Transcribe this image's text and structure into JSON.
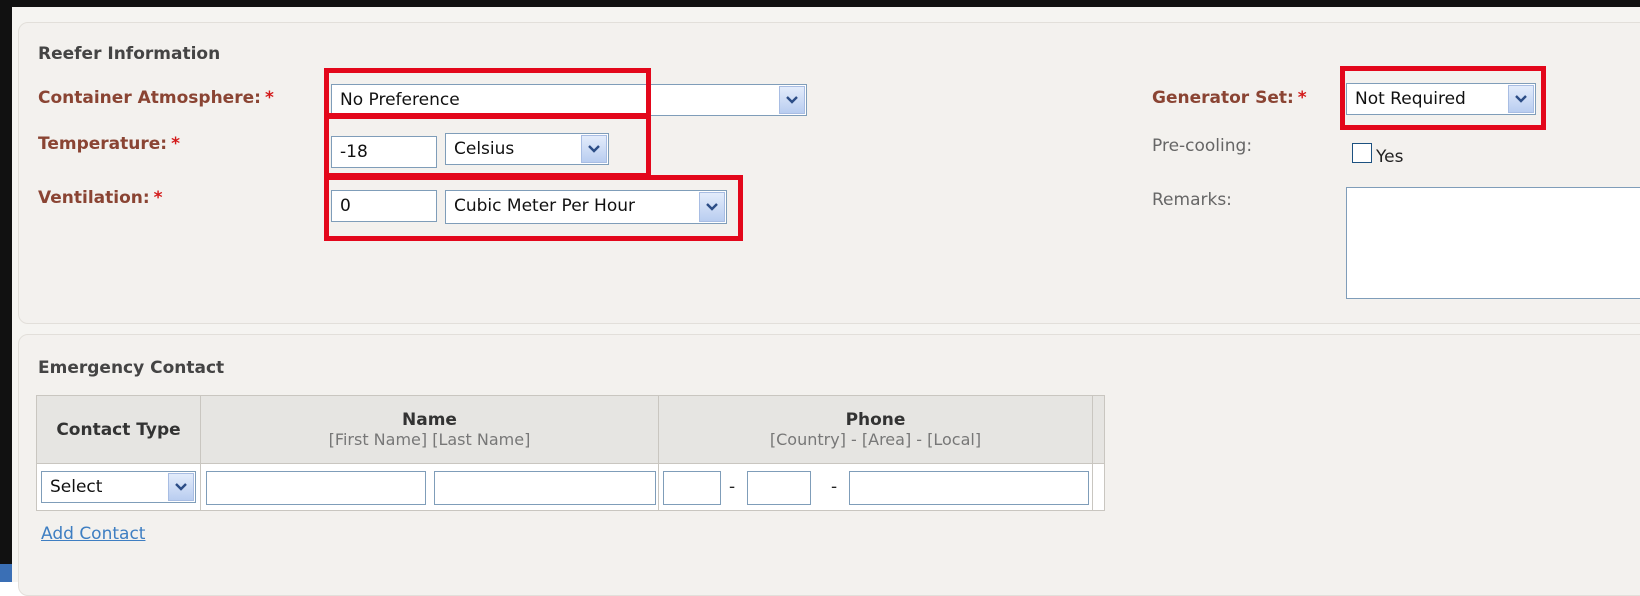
{
  "reefer": {
    "title": "Reefer Information",
    "container_atmosphere": {
      "label": "Container Atmosphere:",
      "required": "*",
      "value": "No Preference"
    },
    "temperature": {
      "label": "Temperature:",
      "required": "*",
      "value": "-18",
      "unit": "Celsius"
    },
    "ventilation": {
      "label": "Ventilation:",
      "required": "*",
      "value": "0",
      "unit": "Cubic Meter Per Hour"
    },
    "generator_set": {
      "label": "Generator Set:",
      "required": "*",
      "value": "Not Required"
    },
    "pre_cooling": {
      "label": "Pre-cooling:",
      "option": "Yes",
      "checked": false
    },
    "remarks": {
      "label": "Remarks:",
      "value": ""
    }
  },
  "emergency": {
    "title": "Emergency Contact",
    "columns": {
      "contact_type": "Contact Type",
      "name": "Name",
      "name_hint": "[First Name] [Last Name]",
      "phone": "Phone",
      "phone_hint": "[Country] - [Area] - [Local]"
    },
    "row": {
      "contact_type": "Select",
      "first_name": "",
      "last_name": "",
      "phone_country": "",
      "phone_area": "",
      "phone_local": "",
      "separator": "-"
    },
    "add_contact": "Add Contact"
  },
  "colors": {
    "label_text": "#8a4433",
    "required_star": "#d31a1a",
    "highlight": "#e3071b",
    "link": "#3e7ec2"
  }
}
